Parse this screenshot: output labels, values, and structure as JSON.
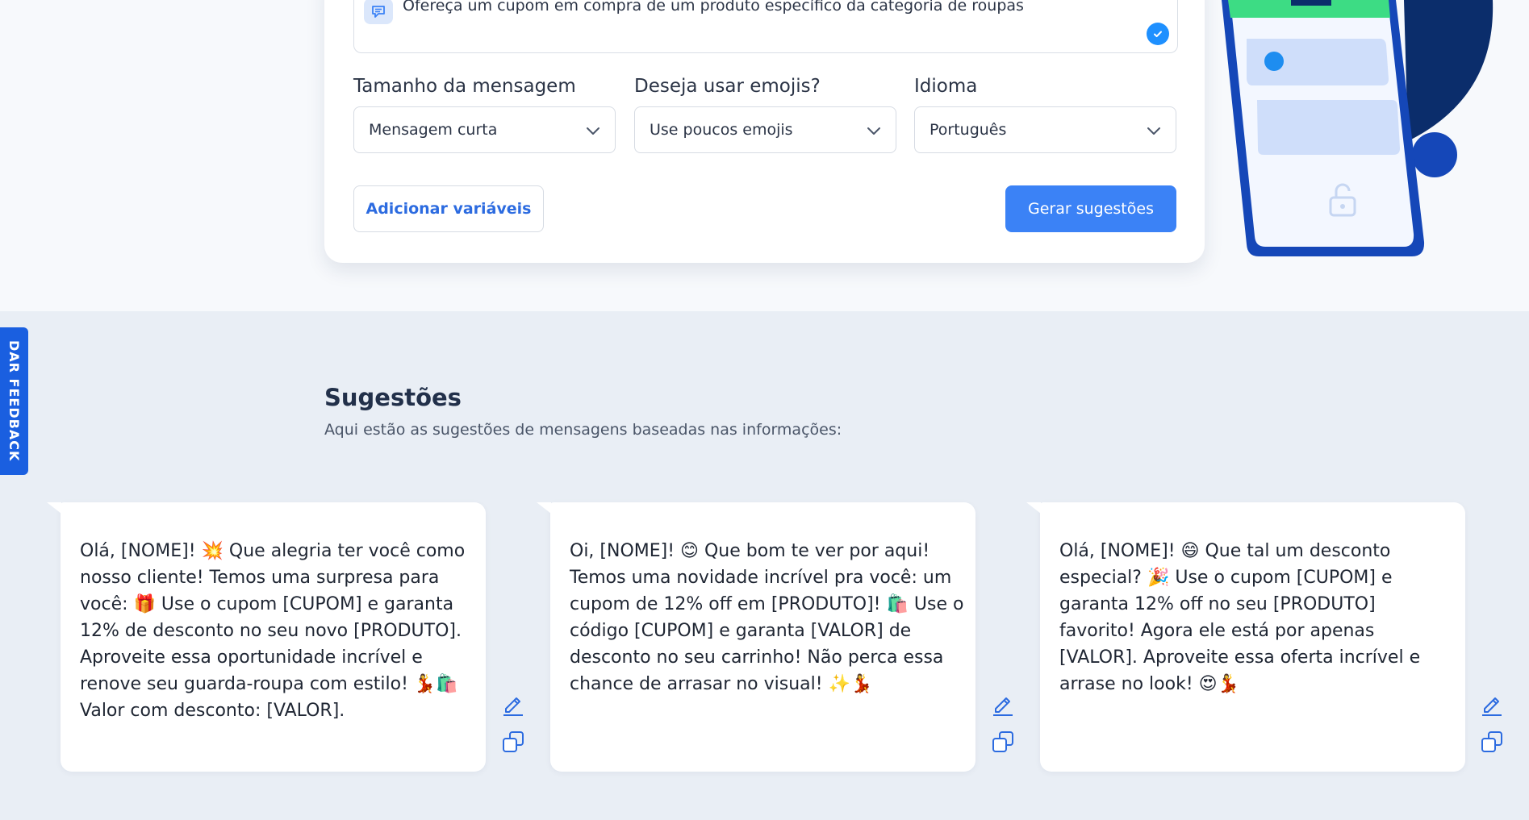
{
  "form": {
    "objective_text": "Ofereça um cupom em compra de um produto específico da categoria de roupas",
    "fields": [
      {
        "label": "Tamanho da mensagem",
        "value": "Mensagem curta"
      },
      {
        "label": "Deseja usar emojis?",
        "value": "Use poucos emojis"
      },
      {
        "label": "Idioma",
        "value": "Português"
      }
    ],
    "add_variables_label": "Adicionar variáveis",
    "generate_label": "Gerar sugestões"
  },
  "feedback_tab": "DAR FEEDBACK",
  "suggestions": {
    "title": "Sugestões",
    "subtitle": "Aqui estão as sugestões de mensagens baseadas nas informações:",
    "items": [
      {
        "text": "Olá, [NOME]! 💥 Que alegria ter você como nosso cliente! Temos uma surpresa para você: 🎁 Use o cupom [CUPOM] e garanta 12% de desconto no seu novo [PRODUTO]. Aproveite essa oportunidade incrível e renove seu guarda-roupa com estilo! 💃🛍️ Valor com desconto: [VALOR]."
      },
      {
        "text": "Oi, [NOME]! 😊 Que bom te ver por aqui! Temos uma novidade incrível pra você: um cupom de 12% off em [PRODUTO]! 🛍️ Use o código [CUPOM] e garanta [VALOR] de desconto no seu carrinho! Não perca essa chance de arrasar no visual! ✨💃"
      },
      {
        "text": "Olá, [NOME]! 😄 Que tal um desconto especial? 🎉 Use o cupom [CUPOM] e garanta 12% off no seu [PRODUTO] favorito! Agora ele está por apenas [VALOR]. Aproveite essa oferta incrível e arrase no look! 😍💃"
      }
    ]
  },
  "colors": {
    "accent": "#3b82f6",
    "link": "#2c6be0",
    "phone_frame": "#1547b8",
    "phone_header": "#3ddc84",
    "dark_blob": "#0b2d6b"
  }
}
